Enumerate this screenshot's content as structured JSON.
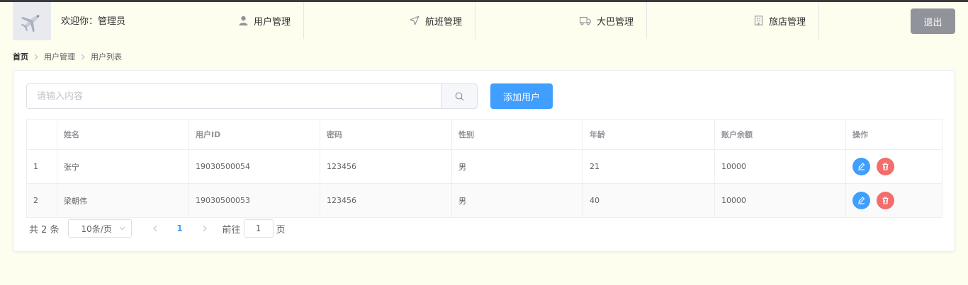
{
  "header": {
    "welcome": "欢迎你：管理员",
    "nav": [
      {
        "label": "用户管理",
        "icon": "user-icon"
      },
      {
        "label": "航班管理",
        "icon": "navigation-icon"
      },
      {
        "label": "大巴管理",
        "icon": "truck-icon"
      },
      {
        "label": "旅店管理",
        "icon": "building-icon"
      }
    ],
    "logout_label": "退出"
  },
  "breadcrumb": [
    "首页",
    "用户管理",
    "用户列表"
  ],
  "search": {
    "placeholder": "请输入内容",
    "value": ""
  },
  "add_button_label": "添加用户",
  "table": {
    "columns": [
      "",
      "姓名",
      "用户ID",
      "密码",
      "性别",
      "年龄",
      "账户余额",
      "操作"
    ],
    "rows": [
      {
        "index": "1",
        "name": "张宁",
        "user_id": "19030500054",
        "password": "123456",
        "gender": "男",
        "age": "21",
        "balance": "10000"
      },
      {
        "index": "2",
        "name": "梁朝伟",
        "user_id": "19030500053",
        "password": "123456",
        "gender": "男",
        "age": "40",
        "balance": "10000"
      }
    ]
  },
  "pagination": {
    "total_text": "共 2 条",
    "page_size": "10条/页",
    "current_page": "1",
    "goto_label": "前往",
    "goto_value": "1",
    "page_suffix": "页"
  },
  "colors": {
    "primary": "#409eff",
    "danger": "#f56c6c",
    "logout": "#909399",
    "background": "#fefeee"
  }
}
